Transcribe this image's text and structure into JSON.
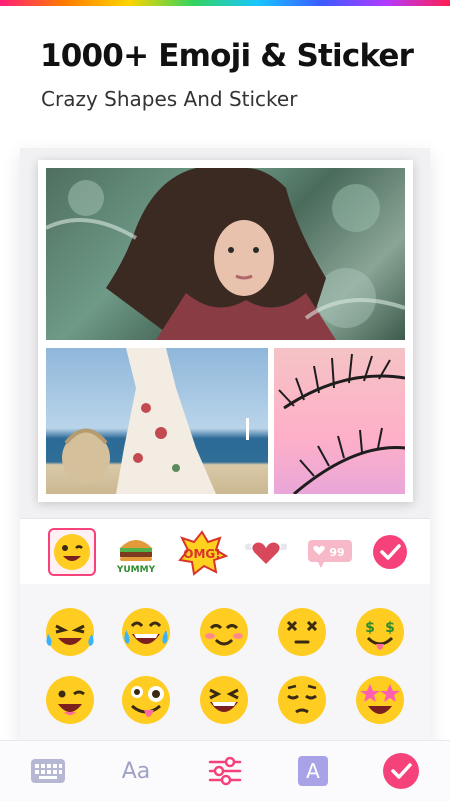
{
  "header": {
    "title": "1000+ Emoji & Sticker",
    "subtitle": "Crazy Shapes And Sticker"
  },
  "collage": {
    "photos": [
      "portrait-photo",
      "beach-dress-photo",
      "palm-leaves-photo"
    ]
  },
  "sticker_tabs": {
    "items": [
      "emoji-face-icon",
      "burger-yummy-sticker",
      "omg-sticker",
      "winged-heart-sticker",
      "likes-badge-sticker",
      "confirm-icon"
    ],
    "omg_text": "OMG!",
    "yummy_text": "YUMMY",
    "likes_count": "99",
    "selected_index": 0
  },
  "emoji_grid": {
    "rows": [
      [
        "laughing-tears",
        "joy-tears",
        "blushing-smile",
        "dizzy-face",
        "money-mouth"
      ],
      [
        "winking-face",
        "zany-face",
        "grinning-squint",
        "pensive-face",
        "star-struck"
      ]
    ]
  },
  "toolbar": {
    "items": [
      "keyboard-icon",
      "text-style-icon",
      "adjust-sliders-icon",
      "font-box-icon",
      "confirm-check-icon"
    ],
    "text_style_label": "Aa",
    "font_box_label": "A",
    "active_index": 2
  },
  "colors": {
    "accent": "#f5427a",
    "emoji_yellow": "#ffcc22",
    "tool_gray": "#9fa2c4",
    "font_box": "#a8a3e6"
  }
}
